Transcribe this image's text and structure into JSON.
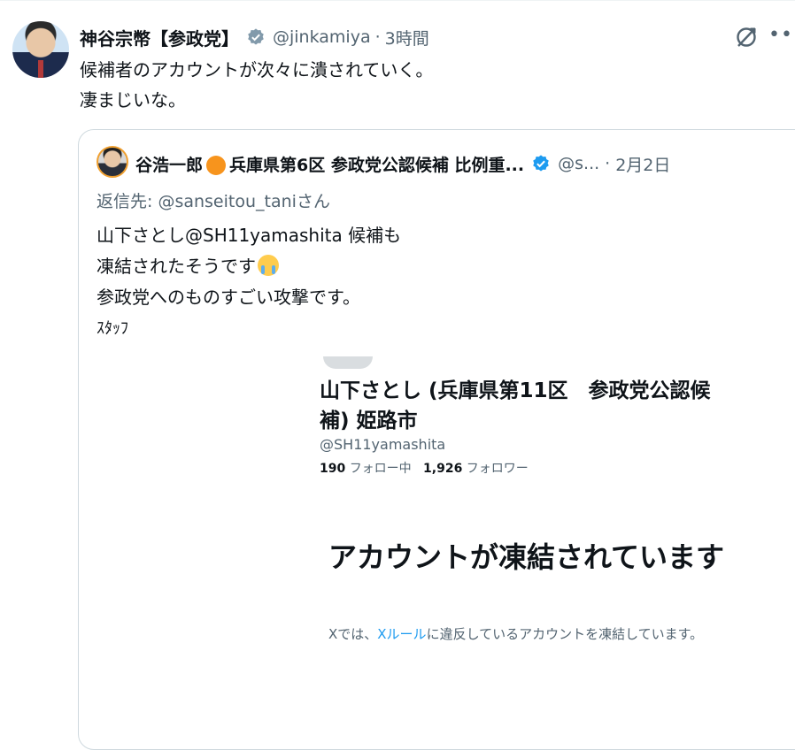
{
  "tweet": {
    "author_name": "神谷宗幣【参政党】",
    "handle": "@jinkamiya",
    "separator": "·",
    "time": "3時間",
    "lines": [
      "候補者のアカウントが次々に潰されていく。",
      "凄まじいな。"
    ]
  },
  "quote": {
    "author_name_part1": "谷浩一郎",
    "author_name_part2": "兵庫県第6区 参政党公認候補 比例重...",
    "handle": "@s...",
    "separator": "·",
    "time": "2月2日",
    "reply_label": "返信先: ",
    "reply_mention": "@sanseitou_tani",
    "reply_suffix": "さん",
    "line1": "山下さとし@SH11yamashita 候補も",
    "line2": "凍結されたそうです",
    "line3": "参政党へのものすごい攻撃です。",
    "line4": "ｽﾀｯﾌ",
    "emoji": "loudly-crying-face"
  },
  "screenshot": {
    "profile_name": "山下さとし (兵庫県第11区　参政党公認候補) 姫路市",
    "profile_handle": "@SH11yamashita",
    "following_count": "190",
    "following_label": "フォロー中",
    "followers_count": "1,926",
    "followers_label": "フォロワー",
    "suspended_title": "アカウントが凍結されています",
    "desc_prefix": "Xでは、",
    "desc_link": "Xルール",
    "desc_suffix": "に違反しているアカウントを凍結しています。"
  },
  "colors": {
    "verified_blue": "#1d9bf0",
    "secondary_text": "#536471",
    "badge_orange": "#f7941d"
  }
}
